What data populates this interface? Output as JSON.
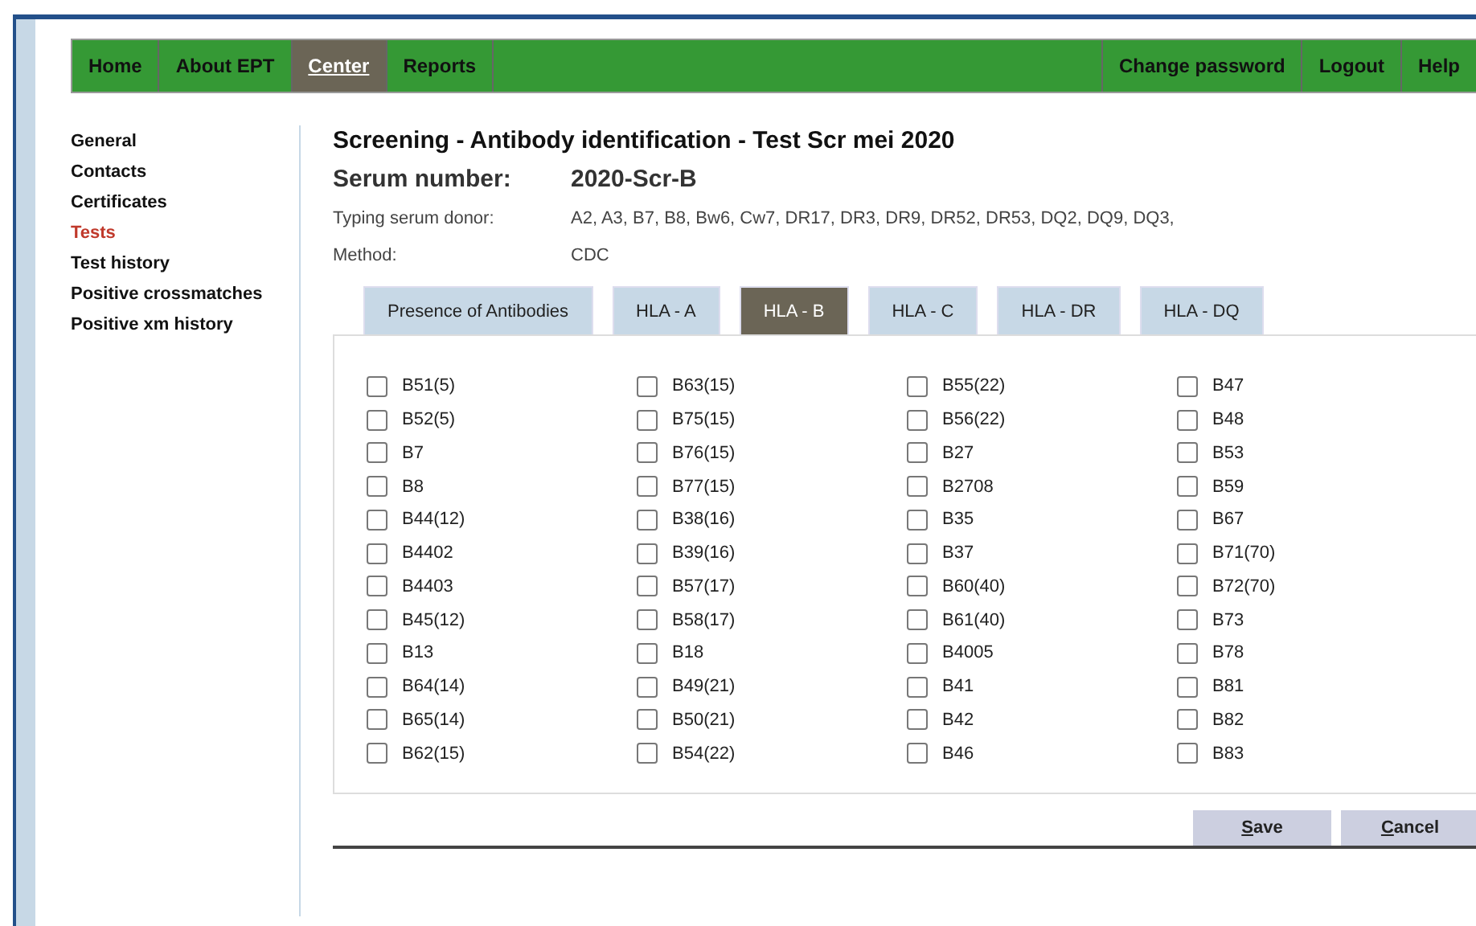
{
  "nav": {
    "left": [
      {
        "label": "Home",
        "selected": false
      },
      {
        "label": "About EPT",
        "selected": false
      },
      {
        "label": "Center",
        "selected": true
      },
      {
        "label": "Reports",
        "selected": false
      }
    ],
    "right": [
      {
        "label": "Change password"
      },
      {
        "label": "Logout"
      },
      {
        "label": "Help"
      }
    ]
  },
  "sidebar": {
    "items": [
      {
        "label": "General",
        "selected": false
      },
      {
        "label": "Contacts",
        "selected": false
      },
      {
        "label": "Certificates",
        "selected": false
      },
      {
        "label": "Tests",
        "selected": true
      },
      {
        "label": "Test history",
        "selected": false
      },
      {
        "label": "Positive crossmatches",
        "selected": false
      },
      {
        "label": "Positive xm history",
        "selected": false
      }
    ]
  },
  "title": "Screening - Antibody identification - Test Scr mei 2020",
  "serum": {
    "label": "Serum number:",
    "value": "2020-Scr-B"
  },
  "info": [
    {
      "label": "Typing serum donor:",
      "value": "A2, A3, B7, B8, Bw6, Cw7, DR17, DR3, DR9, DR52, DR53, DQ2, DQ9, DQ3,"
    },
    {
      "label": "Method:",
      "value": "CDC"
    }
  ],
  "tabs": [
    {
      "label": "Presence of Antibodies",
      "selected": false
    },
    {
      "label": "HLA - A",
      "selected": false
    },
    {
      "label": "HLA - B",
      "selected": true
    },
    {
      "label": "HLA - C",
      "selected": false
    },
    {
      "label": "HLA - DR",
      "selected": false
    },
    {
      "label": "HLA - DQ",
      "selected": false
    }
  ],
  "columns": [
    [
      {
        "label": "B51(5)",
        "checked": false
      },
      {
        "label": "B52(5)",
        "checked": false
      },
      {
        "label": "B7",
        "checked": false
      },
      {
        "label": "B8",
        "checked": false
      },
      {
        "label": "B44(12)",
        "checked": false
      },
      {
        "label": "B4402",
        "checked": false
      },
      {
        "label": "B4403",
        "checked": false
      },
      {
        "label": "B45(12)",
        "checked": false
      },
      {
        "label": "B13",
        "checked": false
      },
      {
        "label": "B64(14)",
        "checked": false
      },
      {
        "label": "B65(14)",
        "checked": false
      },
      {
        "label": "B62(15)",
        "checked": false
      }
    ],
    [
      {
        "label": "B63(15)",
        "checked": false
      },
      {
        "label": "B75(15)",
        "checked": false
      },
      {
        "label": "B76(15)",
        "checked": false
      },
      {
        "label": "B77(15)",
        "checked": false
      },
      {
        "label": "B38(16)",
        "checked": false
      },
      {
        "label": "B39(16)",
        "checked": false
      },
      {
        "label": "B57(17)",
        "checked": false
      },
      {
        "label": "B58(17)",
        "checked": false
      },
      {
        "label": "B18",
        "checked": false
      },
      {
        "label": "B49(21)",
        "checked": false
      },
      {
        "label": "B50(21)",
        "checked": false
      },
      {
        "label": "B54(22)",
        "checked": false
      }
    ],
    [
      {
        "label": "B55(22)",
        "checked": false
      },
      {
        "label": "B56(22)",
        "checked": false
      },
      {
        "label": "B27",
        "checked": false
      },
      {
        "label": "B2708",
        "checked": false
      },
      {
        "label": "B35",
        "checked": false
      },
      {
        "label": "B37",
        "checked": false
      },
      {
        "label": "B60(40)",
        "checked": false
      },
      {
        "label": "B61(40)",
        "checked": false
      },
      {
        "label": "B4005",
        "checked": false
      },
      {
        "label": "B41",
        "checked": false
      },
      {
        "label": "B42",
        "checked": false
      },
      {
        "label": "B46",
        "checked": false
      }
    ],
    [
      {
        "label": "B47",
        "checked": false
      },
      {
        "label": "B48",
        "checked": false
      },
      {
        "label": "B53",
        "checked": false
      },
      {
        "label": "B59",
        "checked": false
      },
      {
        "label": "B67",
        "checked": false
      },
      {
        "label": "B71(70)",
        "checked": false
      },
      {
        "label": "B72(70)",
        "checked": false
      },
      {
        "label": "B73",
        "checked": false
      },
      {
        "label": "B78",
        "checked": false
      },
      {
        "label": "B81",
        "checked": false
      },
      {
        "label": "B82",
        "checked": false
      },
      {
        "label": "B83",
        "checked": false
      }
    ]
  ],
  "buttons": [
    {
      "label": "Save"
    },
    {
      "label": "Cancel"
    }
  ]
}
